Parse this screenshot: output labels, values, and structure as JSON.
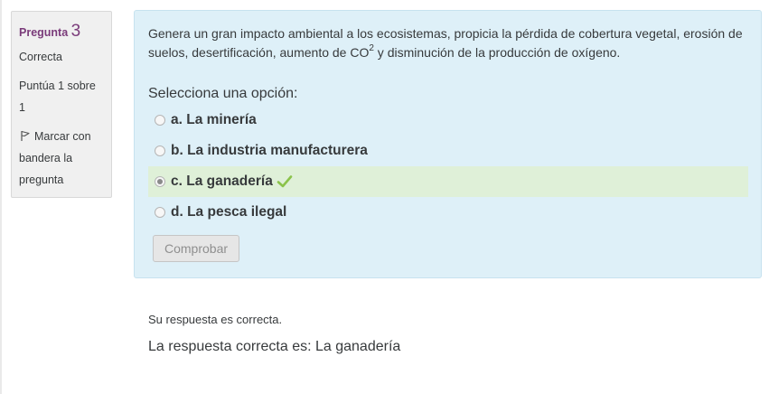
{
  "info": {
    "question_label": "Pregunta",
    "question_number": "3",
    "state": "Correcta",
    "grade": "Puntúa 1 sobre 1",
    "flag_label": "Marcar con bandera la pregunta"
  },
  "question": {
    "text_before_sup": "Genera un gran impacto ambiental a los ecosistemas, propicia la pérdida de cobertura vegetal, erosión de suelos, desertificación, aumento de CO",
    "sup": "2",
    "text_after_sup": " y disminución de la producción de oxígeno.",
    "prompt": "Selecciona una opción:",
    "options": [
      {
        "label": "a. La minería",
        "checked": false,
        "correct": false
      },
      {
        "label": "b. La industria manufacturera",
        "checked": false,
        "correct": false
      },
      {
        "label": "c. La ganadería",
        "checked": true,
        "correct": true
      },
      {
        "label": "d. La pesca ilegal",
        "checked": false,
        "correct": false
      }
    ],
    "check_button": "Comprobar"
  },
  "feedback": {
    "specific": "Su respuesta es correcta.",
    "right_answer": "La respuesta correcta es: La ganadería"
  },
  "colors": {
    "accent": "#7a3b7a",
    "formulation_bg": "#def0f8",
    "correct_bg": "#dff0d8",
    "check": "#8bc34a"
  },
  "icons": {
    "flag": "flag-icon",
    "correct": "check-icon"
  }
}
